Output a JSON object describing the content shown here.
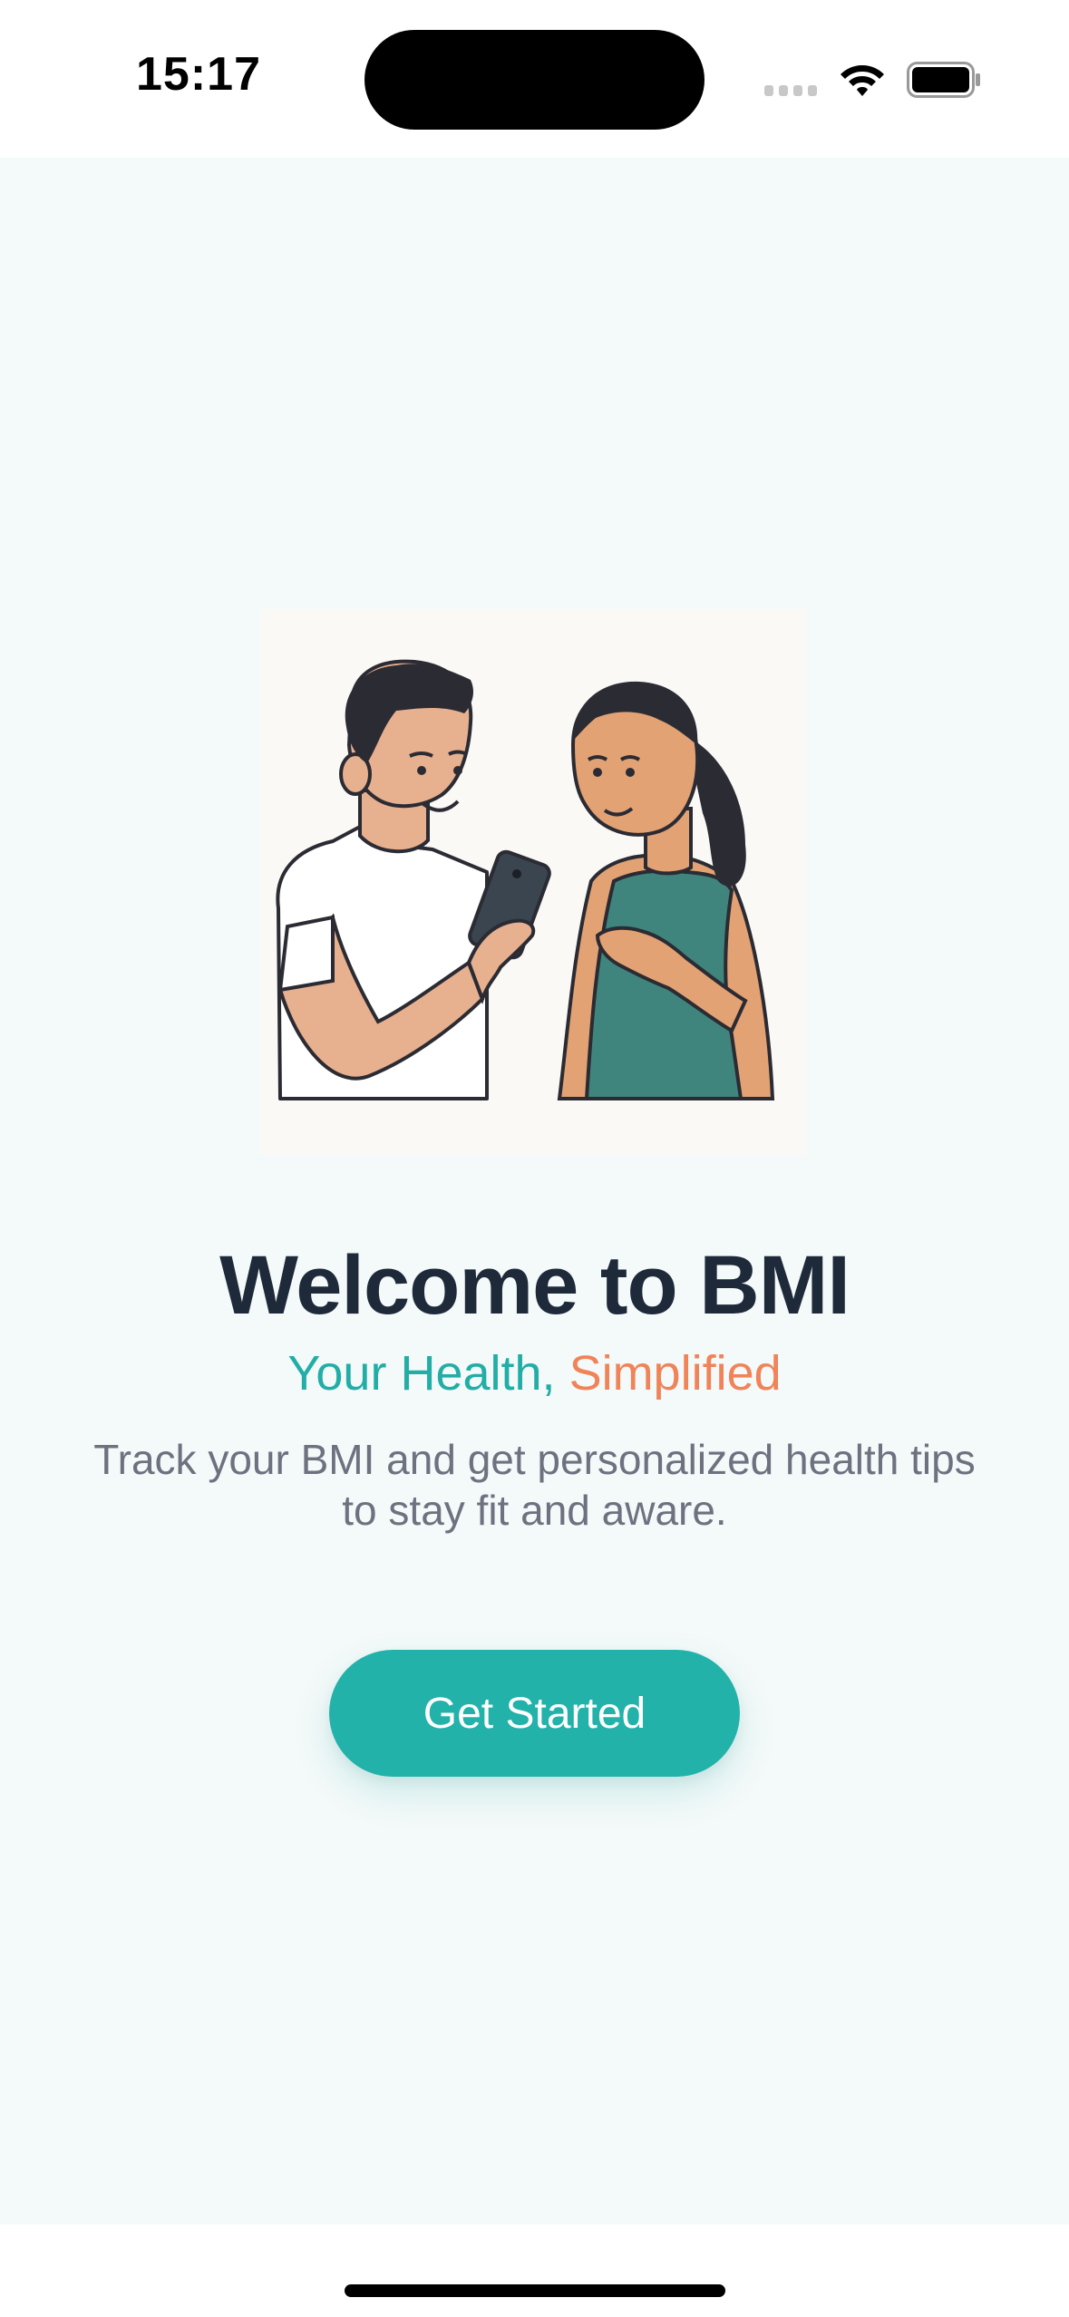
{
  "status_bar": {
    "time": "15:17",
    "icons": [
      "signal-icon",
      "wifi-icon",
      "battery-icon"
    ]
  },
  "illustration": {
    "icon": "people-with-phone-illustration"
  },
  "welcome": {
    "title": "Welcome to BMI",
    "subtitle_part1": "Your Health, ",
    "subtitle_part2": "Simplified",
    "description": "Track your BMI and get personalized health tips to stay fit and aware."
  },
  "actions": {
    "get_started_label": "Get Started"
  },
  "colors": {
    "accent": "#22b2aa",
    "highlight": "#f08459",
    "title": "#1e2a3a",
    "body_text": "#6e7280",
    "background": "#f4f9f9"
  }
}
